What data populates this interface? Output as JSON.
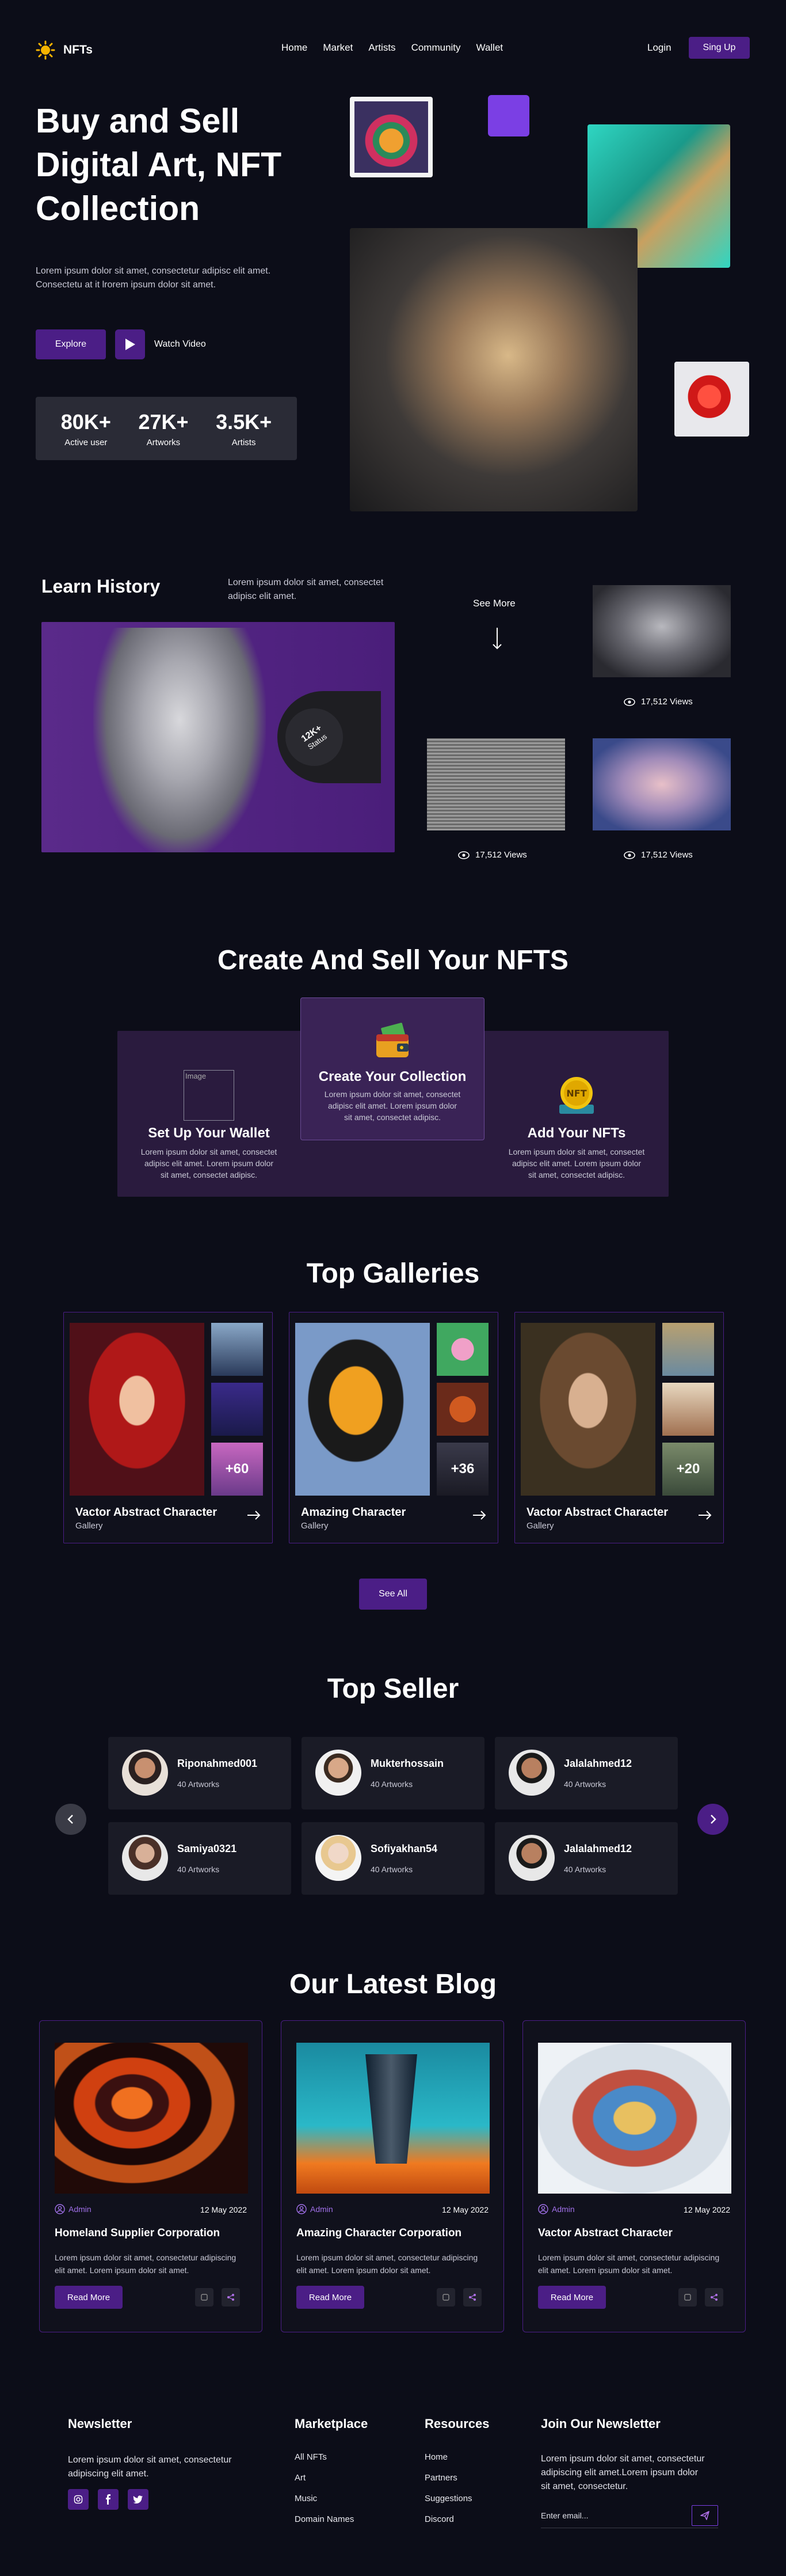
{
  "brand": {
    "name": "NFTs"
  },
  "nav": {
    "items": [
      "Home",
      "Market",
      "Artists",
      "Community",
      "Wallet"
    ],
    "login": "Login",
    "signup": "Sing Up"
  },
  "hero": {
    "title_lines": [
      "Buy and Sell",
      "Digital Art, NFT",
      "Collection"
    ],
    "text_lines": [
      "Lorem ipsum dolor sit amet, consectetur adipisc elit amet.",
      "Consectetu at it lrorem ipsum dolor sit amet."
    ],
    "explore": "Explore",
    "watch": "Watch Video",
    "stats": [
      {
        "value": "80K+",
        "label": "Active user"
      },
      {
        "value": "27K+",
        "label": "Artworks"
      },
      {
        "value": "3.5K+",
        "label": "Artists"
      }
    ]
  },
  "history": {
    "title": "Learn History",
    "text_lines": [
      "Lorem ipsum dolor sit amet, consectet",
      "adipisc elit amet."
    ],
    "badge_value": "12K+",
    "badge_label": "Status",
    "see_more": "See More",
    "views": [
      "17,512 Views",
      "17,512 Views",
      "17,512 Views"
    ]
  },
  "create": {
    "title": "Create And Sell Your NFTS",
    "cards": [
      {
        "title": "Set Up Your Wallet",
        "img_alt": "Image",
        "lines": [
          "Lorem ipsum dolor sit amet, consectet",
          "adipisc elit amet. Lorem ipsum dolor",
          "sit amet, consectet adipisc."
        ]
      },
      {
        "title": "Create Your Collection",
        "lines": [
          "Lorem ipsum dolor sit amet, consectet",
          "adipisc elit amet. Lorem ipsum dolor",
          "sit amet, consectet adipisc."
        ]
      },
      {
        "title": "Add Your NFTs",
        "badge": "NFT",
        "lines": [
          "Lorem ipsum dolor sit amet, consectet",
          "adipisc elit amet. Lorem ipsum dolor",
          "sit amet, consectet adipisc."
        ]
      }
    ]
  },
  "galleries": {
    "title": "Top Galleries",
    "items": [
      {
        "title": "Vactor Abstract Character",
        "sub": "Gallery",
        "more": "+60"
      },
      {
        "title": "Amazing Character",
        "sub": "Gallery",
        "more": "+36"
      },
      {
        "title": "Vactor Abstract Character",
        "sub": "Gallery",
        "more": "+20"
      }
    ],
    "see_all": "See All"
  },
  "sellers": {
    "title": "Top Seller",
    "items": [
      {
        "name": "Riponahmed001",
        "count": "40 Artworks"
      },
      {
        "name": "Mukterhossain",
        "count": "40 Artworks"
      },
      {
        "name": "Jalalahmed12",
        "count": "40 Artworks"
      },
      {
        "name": "Samiya0321",
        "count": "40 Artworks"
      },
      {
        "name": "Sofiyakhan54",
        "count": "40 Artworks"
      },
      {
        "name": "Jalalahmed12",
        "count": "40 Artworks"
      }
    ]
  },
  "blog": {
    "title": "Our Latest Blog",
    "posts": [
      {
        "author": "Admin",
        "date": "12 May 2022",
        "title": "Homeland Supplier Corporation",
        "lines": [
          "Lorem ipsum dolor sit amet, consectetur adipiscing",
          "elit amet. Lorem ipsum dolor sit amet."
        ],
        "read": "Read More"
      },
      {
        "author": "Admin",
        "date": "12 May 2022",
        "title": "Amazing Character Corporation",
        "lines": [
          "Lorem ipsum dolor sit amet, consectetur adipiscing",
          "elit amet. Lorem ipsum dolor sit amet."
        ],
        "read": "Read More"
      },
      {
        "author": "Admin",
        "date": "12 May 2022",
        "title": "Vactor Abstract Character",
        "lines": [
          "Lorem ipsum dolor sit amet, consectetur adipiscing",
          "elit amet. Lorem ipsum dolor sit amet."
        ],
        "read": "Read More"
      }
    ]
  },
  "footer": {
    "newsletter": {
      "title": "Newsletter",
      "lines": [
        "Lorem ipsum dolor sit amet, consectetur",
        "adipiscing elit amet."
      ]
    },
    "marketplace": {
      "title": "Marketplace",
      "links": [
        "All NFTs",
        "Art",
        "Music",
        "Domain Names"
      ]
    },
    "resources": {
      "title": "Resources",
      "links": [
        "Home",
        "Partners",
        "Suggestions",
        "Discord"
      ]
    },
    "join": {
      "title": "Join Our Newsletter",
      "lines": [
        "Lorem ipsum dolor sit amet, consectetur",
        "adipiscing elit amet.Lorem ipsum dolor",
        "sit amet, consectetur."
      ],
      "placeholder": "Enter email..."
    }
  },
  "colors": {
    "bg": "#0c0d18",
    "accent": "#4b1e86",
    "accent_light": "#7b3fe4",
    "card": "#1a1b26"
  }
}
